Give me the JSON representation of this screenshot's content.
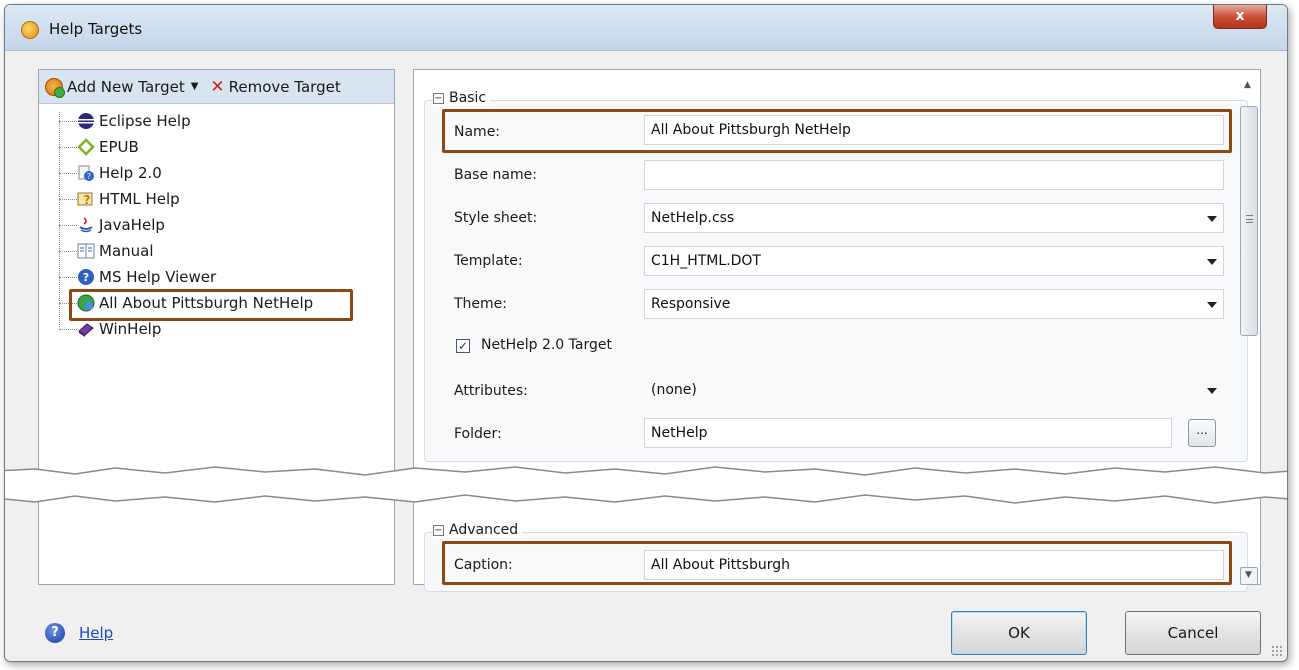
{
  "window": {
    "title": "Help Targets",
    "close_label": "x"
  },
  "left_toolbar": {
    "add_label": "Add New Target",
    "remove_label": "Remove Target"
  },
  "tree": {
    "items": [
      {
        "label": "Eclipse Help",
        "icon": "eclipse-icon"
      },
      {
        "label": "EPUB",
        "icon": "epub-icon"
      },
      {
        "label": "Help 2.0",
        "icon": "help2-icon"
      },
      {
        "label": "HTML Help",
        "icon": "html-help-icon"
      },
      {
        "label": "JavaHelp",
        "icon": "java-icon"
      },
      {
        "label": "Manual",
        "icon": "manual-icon"
      },
      {
        "label": "MS Help Viewer",
        "icon": "ms-help-viewer-icon"
      },
      {
        "label": "All About Pittsburgh NetHelp",
        "icon": "nethelp-icon",
        "selected": true
      },
      {
        "label": "WinHelp",
        "icon": "winhelp-icon"
      }
    ]
  },
  "basic": {
    "legend": "Basic",
    "name_label": "Name:",
    "name_value": "All About Pittsburgh NetHelp",
    "base_name_label": "Base name:",
    "base_name_value": "",
    "style_sheet_label": "Style sheet:",
    "style_sheet_value": "NetHelp.css",
    "template_label": "Template:",
    "template_value": "C1H_HTML.DOT",
    "theme_label": "Theme:",
    "theme_value": "Responsive",
    "nethelp_checkbox_label": "NetHelp 2.0 Target",
    "nethelp_checked": true,
    "attributes_label": "Attributes:",
    "attributes_value": "(none)",
    "folder_label": "Folder:",
    "folder_value": "NetHelp",
    "browse_label": "..."
  },
  "advanced": {
    "legend": "Advanced",
    "caption_label": "Caption:",
    "caption_value": "All About Pittsburgh"
  },
  "footer": {
    "help_label": "Help",
    "ok_label": "OK",
    "cancel_label": "Cancel"
  },
  "colors": {
    "highlight": "#8b4a13",
    "toolbar_bg": "#d9e4f1"
  }
}
